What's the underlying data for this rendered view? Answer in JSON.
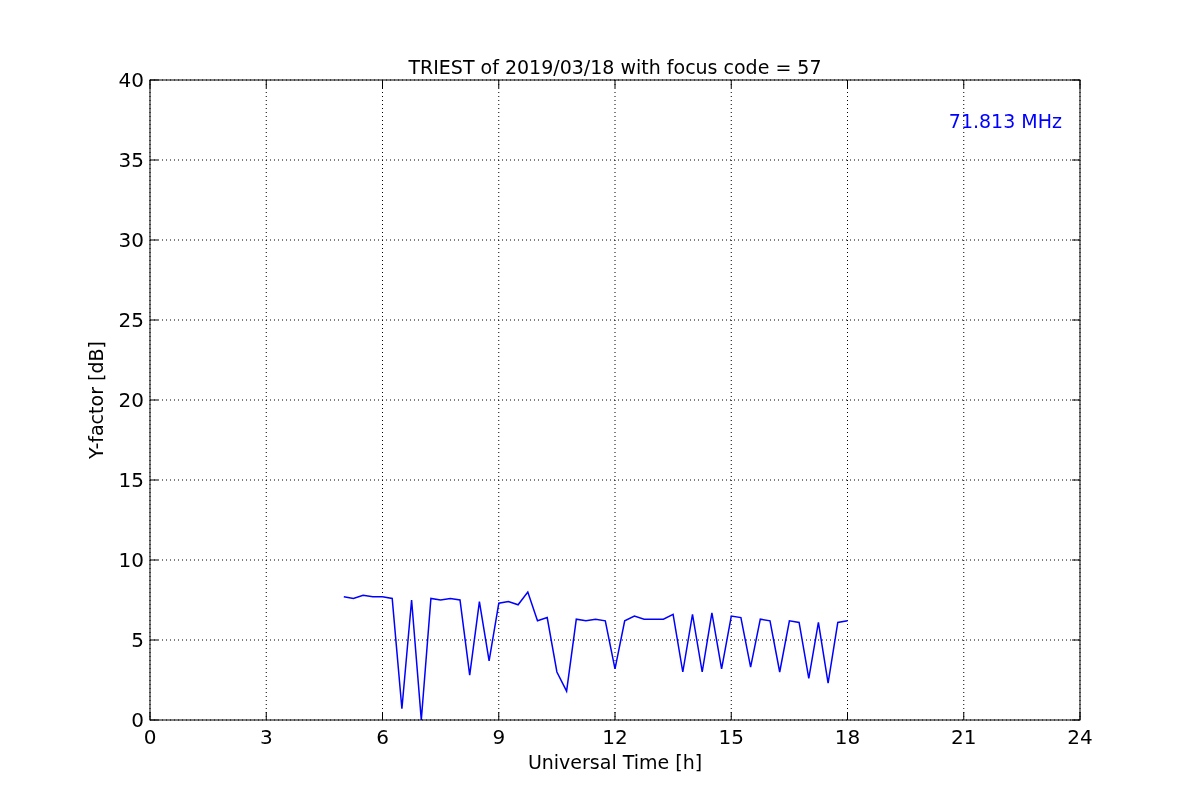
{
  "chart_data": {
    "type": "line",
    "title": "TRIEST of 2019/03/18 with focus code = 57",
    "xlabel": "Universal Time [h]",
    "ylabel": "Y-factor [dB]",
    "x": [
      5,
      5.25,
      5.5,
      5.75,
      6,
      6.25,
      6.5,
      6.75,
      7,
      7.25,
      7.5,
      7.75,
      8,
      8.25,
      8.5,
      8.75,
      9,
      9.25,
      9.5,
      9.75,
      10,
      10.25,
      10.5,
      10.75,
      11,
      11.25,
      11.5,
      11.75,
      12,
      12.25,
      12.5,
      12.75,
      13,
      13.25,
      13.5,
      13.75,
      14,
      14.25,
      14.5,
      14.75,
      15,
      15.25,
      15.5,
      15.75,
      16,
      16.25,
      16.5,
      16.75,
      17,
      17.25,
      17.5,
      17.75,
      18
    ],
    "series": [
      {
        "name": "71.813 MHz",
        "color": "#0000ff",
        "values": [
          7.7,
          7.6,
          7.8,
          7.7,
          7.7,
          7.6,
          0.7,
          7.5,
          0.0,
          7.6,
          7.5,
          7.6,
          7.5,
          2.8,
          7.4,
          3.7,
          7.3,
          7.4,
          7.2,
          8.0,
          6.2,
          6.4,
          3.0,
          1.8,
          6.3,
          6.2,
          6.3,
          6.2,
          3.2,
          6.2,
          6.5,
          6.3,
          6.3,
          6.3,
          6.6,
          3.0,
          6.6,
          3.0,
          6.7,
          3.2,
          6.5,
          6.4,
          3.3,
          6.3,
          6.2,
          3.0,
          6.2,
          6.1,
          2.6,
          6.1,
          2.3,
          6.1,
          6.2
        ]
      }
    ],
    "xlim": [
      0,
      24
    ],
    "ylim": [
      0,
      40
    ],
    "xticks": [
      0,
      3,
      6,
      9,
      12,
      15,
      18,
      21,
      24
    ],
    "yticks": [
      0,
      5,
      10,
      15,
      20,
      25,
      30,
      35,
      40
    ],
    "grid": true
  }
}
